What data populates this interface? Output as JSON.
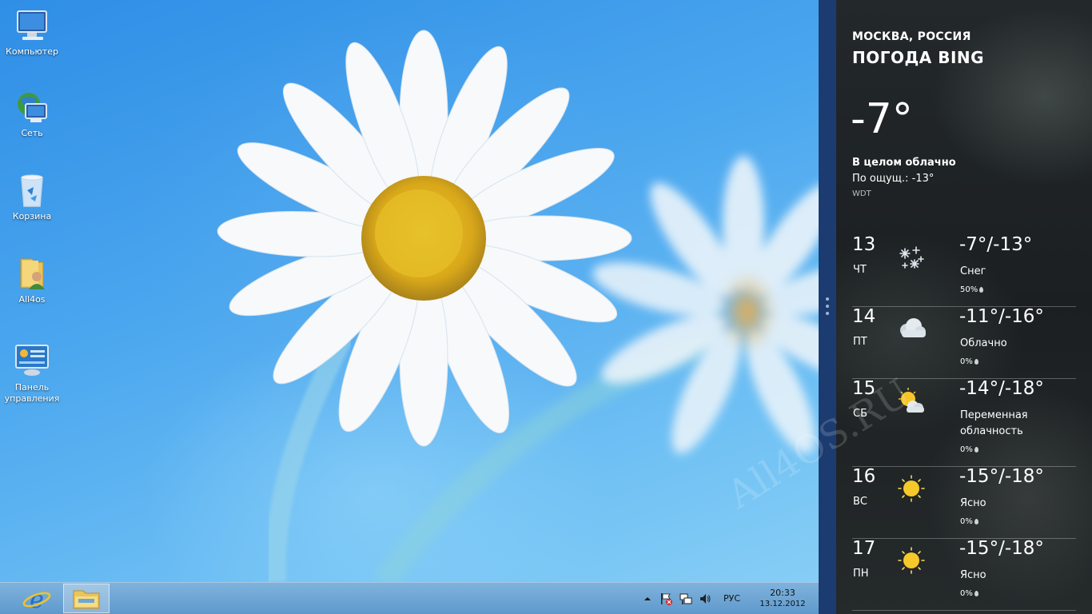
{
  "desktop": {
    "icons": [
      {
        "label": "Компьютер"
      },
      {
        "label": "Сеть"
      },
      {
        "label": "Корзина"
      },
      {
        "label": "All4os"
      },
      {
        "label": "Панель управления"
      }
    ]
  },
  "taskbar": {
    "pinned": [
      {
        "icon": "internet-explorer-icon"
      },
      {
        "icon": "file-explorer-icon",
        "active": true
      }
    ],
    "tray": {
      "language": "РУС",
      "time": "20:33",
      "date": "13.12.2012"
    }
  },
  "weather": {
    "location": "МОСКВА, РОССИЯ",
    "app_title": "ПОГОДА BING",
    "current": {
      "temp": "-7°",
      "condition": "В целом облачно",
      "feels_like": "По ощущ.: -13°",
      "source": "WDT"
    },
    "forecast": [
      {
        "day": "13",
        "dow": "ЧТ",
        "icon": "snow-icon",
        "temps": "-7°/-13°",
        "condition": "Снег",
        "precip": "50%"
      },
      {
        "day": "14",
        "dow": "ПТ",
        "icon": "cloudy-icon",
        "temps": "-11°/-16°",
        "condition": "Облачно",
        "precip": "0%"
      },
      {
        "day": "15",
        "dow": "СБ",
        "icon": "partly-cloudy-icon",
        "temps": "-14°/-18°",
        "condition": "Переменная облачность",
        "precip": "0%"
      },
      {
        "day": "16",
        "dow": "ВС",
        "icon": "sunny-icon",
        "temps": "-15°/-18°",
        "condition": "Ясно",
        "precip": "0%"
      },
      {
        "day": "17",
        "dow": "ПН",
        "icon": "sunny-icon",
        "temps": "-15°/-18°",
        "condition": "Ясно",
        "precip": "0%"
      }
    ]
  },
  "watermark": "All4OS.RU",
  "colors": {
    "taskbar": "#6fa6d4",
    "gutter": "#1c3b70",
    "weather_bg": "#1f2426"
  }
}
